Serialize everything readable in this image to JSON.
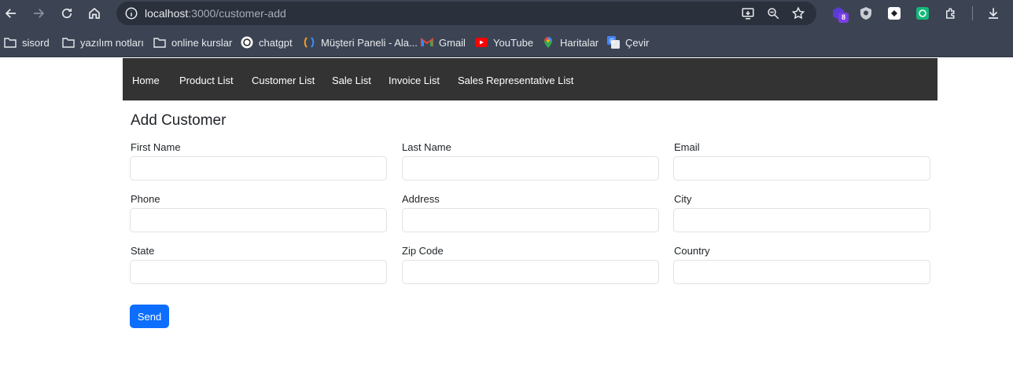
{
  "browser": {
    "url_host": "localhost",
    "url_path": ":3000/customer-add",
    "extension_badge": "8",
    "bookmarks": [
      {
        "label": "sisord",
        "icon": "folder-icon"
      },
      {
        "label": "yazılım notları",
        "icon": "folder-icon"
      },
      {
        "label": "online kurslar",
        "icon": "folder-icon"
      },
      {
        "label": "chatgpt",
        "icon": "chatgpt-icon"
      },
      {
        "label": "Müşteri Paneli - Ala...",
        "icon": "panel-icon"
      },
      {
        "label": "Gmail",
        "icon": "gmail-icon"
      },
      {
        "label": "YouTube",
        "icon": "youtube-icon"
      },
      {
        "label": "Haritalar",
        "icon": "maps-icon"
      },
      {
        "label": "Çevir",
        "icon": "translate-icon"
      }
    ]
  },
  "nav": {
    "items": [
      "Home",
      "Product List",
      "Customer List",
      "Sale List",
      "Invoice List",
      "Sales Representative List"
    ]
  },
  "form": {
    "title": "Add Customer",
    "fields": [
      {
        "label": "First Name",
        "value": ""
      },
      {
        "label": "Last Name",
        "value": ""
      },
      {
        "label": "Email",
        "value": ""
      },
      {
        "label": "Phone",
        "value": ""
      },
      {
        "label": "Address",
        "value": ""
      },
      {
        "label": "City",
        "value": ""
      },
      {
        "label": "State",
        "value": ""
      },
      {
        "label": "Zip Code",
        "value": ""
      },
      {
        "label": "Country",
        "value": ""
      }
    ],
    "submit_label": "Send"
  },
  "colors": {
    "navbar": "#333333",
    "primary": "#0d6efd",
    "chrome": "#3c4454"
  }
}
